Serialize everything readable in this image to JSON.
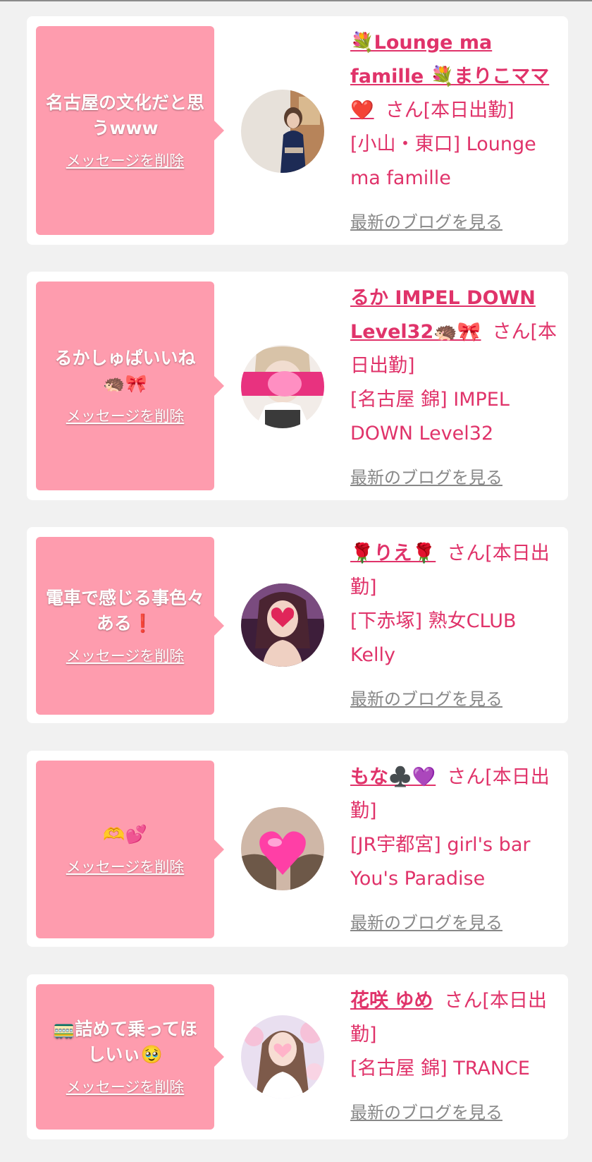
{
  "delete_label": "メッセージを削除",
  "blog_label": "最新のブログを見る",
  "cards": [
    {
      "message": "名古屋の文化だと思うwww",
      "message_emoji": "",
      "name": "💐Lounge ma famille 💐まりこママ❤️",
      "suffix": "さん[本日出勤]",
      "shop": "[小山・東口] Lounge ma famille"
    },
    {
      "message": "るかしゅぱいいね",
      "message_emoji": "🦔🎀",
      "name": "るか IMPEL DOWN Level32🦔🎀",
      "suffix": "さん[本日出勤]",
      "shop": "[名古屋 錦] IMPEL DOWN Level32"
    },
    {
      "message": "電車で感じる事色々ある",
      "message_emoji": "❗",
      "name": "🌹りえ🌹",
      "suffix": "さん[本日出勤]",
      "shop": "[下赤塚] 熟女CLUB Kelly"
    },
    {
      "message": "",
      "message_emoji": "🫶💕",
      "name": "もな♣️💜",
      "suffix": "さん[本日出勤]",
      "shop": "[JR宇都宮] girl's bar You's Paradise"
    },
    {
      "message": "🚃詰めて乗ってほしいぃ",
      "message_emoji": "🥹",
      "name": "花咲 ゆめ",
      "suffix": "さん[本日出勤]",
      "shop": "[名古屋 錦] TRANCE"
    }
  ],
  "colors": {
    "bubble": "#fe9cae",
    "accent": "#e0336a",
    "link_gray": "#888888",
    "background": "#f1f1f1"
  }
}
